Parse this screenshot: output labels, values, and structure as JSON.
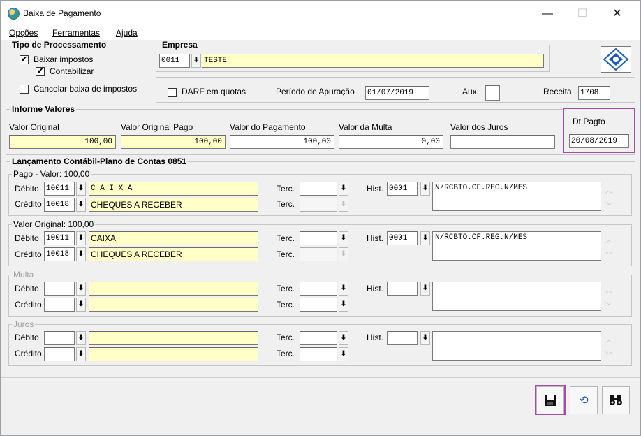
{
  "window": {
    "title": "Baixa de Pagamento",
    "minimize": "—",
    "maximize": "☐",
    "close": "✕"
  },
  "menu": {
    "options": [
      "Opções",
      "Ferramentas",
      "Ajuda"
    ]
  },
  "processing": {
    "legend": "Tipo de Processamento",
    "baixar_impostos": {
      "label": "Baixar impostos",
      "checked": true
    },
    "contabilizar": {
      "label": "Contabilizar",
      "checked": true
    },
    "cancelar": {
      "label": "Cancelar baixa de impostos",
      "checked": false
    }
  },
  "empresa": {
    "legend": "Empresa",
    "code": "0011",
    "name": "TESTE",
    "darf_label": "DARF em quotas",
    "darf_checked": false,
    "periodo_label": "Período de Apuração",
    "periodo_value": "01/07/2019",
    "aux_label": "Aux.",
    "aux_value": "",
    "receita_label": "Receita",
    "receita_value": "1708"
  },
  "valores": {
    "legend": "Informe Valores",
    "valor_original_label": "Valor Original",
    "valor_original": "100,00",
    "valor_original_pago_label": "Valor Original Pago",
    "valor_original_pago": "100,00",
    "valor_pagamento_label": "Valor do Pagamento",
    "valor_pagamento": "100,00",
    "valor_multa_label": "Valor da Multa",
    "valor_multa": "0,00",
    "valor_juros_label": "Valor dos Juros",
    "valor_juros": "",
    "dt_pagto_label": "Dt.Pagto",
    "dt_pagto": "20/08/2019"
  },
  "lancamento": {
    "legend": "Lançamento Contábil-Plano de Contas 0851",
    "labels": {
      "debito": "Débito",
      "credito": "Crédito",
      "terc": "Terc.",
      "hist": "Hist."
    },
    "groups": [
      {
        "legend": "Pago - Valor: 100,00",
        "debito_code": "10011",
        "debito_desc": "C A I X A",
        "credito_code": "10018",
        "credito_desc": "CHEQUES A RECEBER",
        "hist_code": "0001",
        "hist_text": "N/RCBTO.CF.REG.N/MES"
      },
      {
        "legend": "Valor Original: 100,00",
        "debito_code": "10011",
        "debito_desc": "CAIXA",
        "credito_code": "10018",
        "credito_desc": "CHEQUES A RECEBER",
        "hist_code": "0001",
        "hist_text": "N/RCBTO.CF.REG.N/MES"
      },
      {
        "legend": "Multa",
        "debito_code": "",
        "debito_desc": "",
        "credito_code": "",
        "credito_desc": "",
        "hist_code": "",
        "hist_text": ""
      },
      {
        "legend": "Juros",
        "debito_code": "",
        "debito_desc": "",
        "credito_code": "",
        "credito_desc": "",
        "hist_code": "",
        "hist_text": ""
      }
    ]
  },
  "toolbar": {
    "save_icon": "floppy-disk",
    "undo_icon": "undo-arrow",
    "search_icon": "binoculars"
  },
  "colors": {
    "highlight": "#a64aa8",
    "field_yellow": "#ffffc8"
  }
}
